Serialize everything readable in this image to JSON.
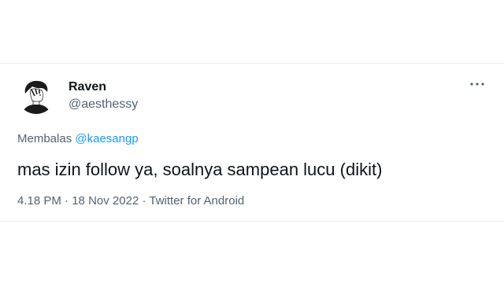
{
  "tweet": {
    "author": {
      "display_name": "Raven",
      "handle": "@aesthessy",
      "avatar_icon": "person-silhouette-avatar"
    },
    "more_icon": "more-dots-icon",
    "reply": {
      "prefix": "Membalas",
      "mention": "@kaesangp"
    },
    "text": "mas izin follow ya, soalnya sampean lucu (dikit)",
    "meta": {
      "time": "4.18 PM",
      "separator": " · ",
      "date": "18 Nov 2022",
      "source": "Twitter for Android"
    },
    "colors": {
      "accent": "#1d9bf0",
      "secondary_text": "#536471",
      "primary_text": "#0f1419"
    }
  }
}
